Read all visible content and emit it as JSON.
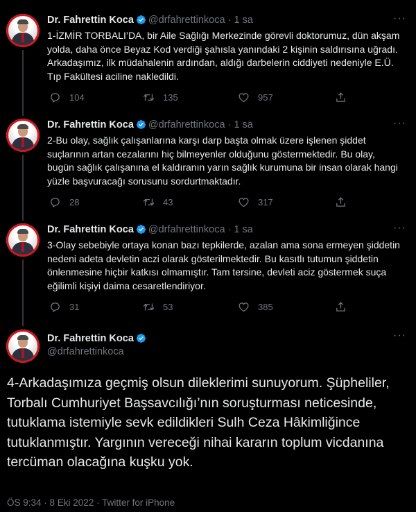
{
  "author": {
    "name": "Dr. Fahrettin Koca",
    "handle": "@drfahrettinkoca"
  },
  "separator": "·",
  "colors": {
    "background": "#000000",
    "text": "#e7e9ea",
    "muted": "#71767b",
    "verified": "#1d9bf0",
    "line": "#333639"
  },
  "tweets": [
    {
      "time": "1 sa",
      "text": "1-İZMİR TORBALI’DA, bir Aile Sağlığı Merkezinde görevli doktorumuz, dün akşam yolda, daha önce Beyaz Kod verdiği şahısla yanındaki 2 kişinin saldırısına uğradı. Arkadaşımız, ilk müdahalenin ardından, aldığı darbelerin ciddiyeti nedeniyle E.Ü. Tıp Fakültesi aciline nakledildi.",
      "replies": "104",
      "retweets": "135",
      "likes": "957"
    },
    {
      "time": "1 sa",
      "text": "2-Bu olay, sağlık çalışanlarına karşı darp başta olmak üzere işlenen şiddet suçlarının artan cezalarını hiç bilmeyenler olduğunu göstermektedir. Bu olay, bugün sağlık çalışanına el kaldıranın yarın sağlık kurumuna bir insan olarak hangi yüzle başvuracağı sorusunu sordurtmaktadır.",
      "replies": "28",
      "retweets": "43",
      "likes": "317"
    },
    {
      "time": "1 sa",
      "text": "3-Olay sebebiyle ortaya konan bazı tepkilerde, azalan ama sona ermeyen şiddetin nedeni adeta devletin aczi olarak gösterilmektedir. Bu kasıtlı tutumun şiddetin önlenmesine hiçbir katkısı olmamıştır. Tam tersine, devleti aciz göstermek suça eğilimli kişiyi daima cesaretlendiriyor.",
      "replies": "31",
      "retweets": "53",
      "likes": "385"
    }
  ],
  "main_tweet": {
    "text": "4-Arkadaşımıza geçmiş olsun dileklerimi sunuyorum. Şüpheliler, Torbalı Cumhuriyet Başsavcılığı’nın soruşturması neticesinde, tutuklama istemiyle sevk edildikleri Sulh Ceza Hâkimliğince tutuklanmıştır. Yargının vereceği nihai kararın toplum vicdanına tercüman olacağına kuşku yok.",
    "timestamp": "ÖS 9:34 · 8 Eki 2022 · Twitter for iPhone"
  },
  "icons": [
    "verified-badge-icon",
    "more-icon",
    "reply-icon",
    "retweet-icon",
    "like-icon",
    "share-icon"
  ]
}
